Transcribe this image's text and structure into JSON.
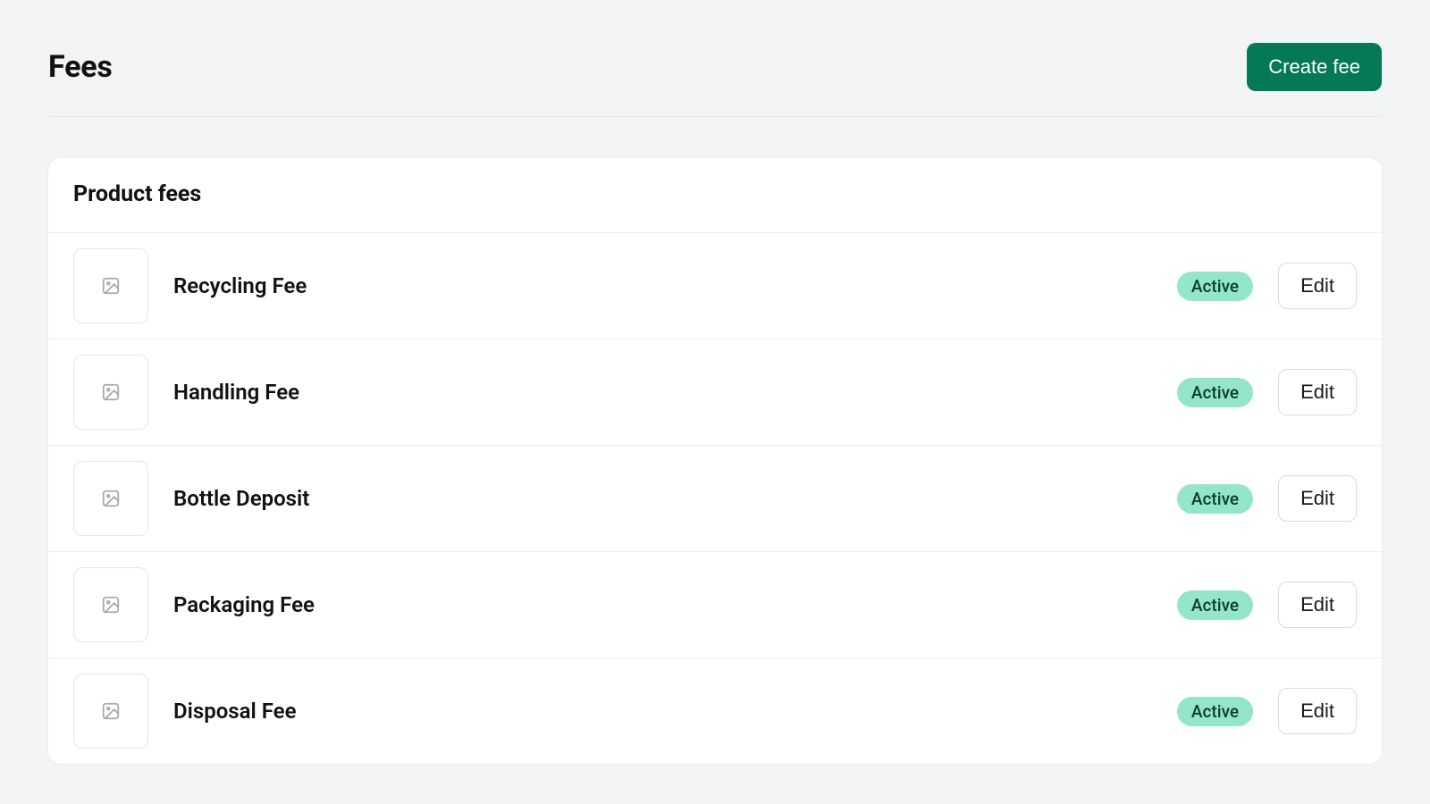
{
  "header": {
    "title": "Fees",
    "create_label": "Create fee"
  },
  "card": {
    "title": "Product fees",
    "edit_label": "Edit",
    "fees": [
      {
        "name": "Recycling Fee",
        "status": "Active"
      },
      {
        "name": "Handling Fee",
        "status": "Active"
      },
      {
        "name": "Bottle Deposit",
        "status": "Active"
      },
      {
        "name": "Packaging Fee",
        "status": "Active"
      },
      {
        "name": "Disposal Fee",
        "status": "Active"
      }
    ]
  },
  "colors": {
    "primary": "#047857",
    "badge_bg": "#94e6c9",
    "page_bg": "#f3f4f5"
  }
}
